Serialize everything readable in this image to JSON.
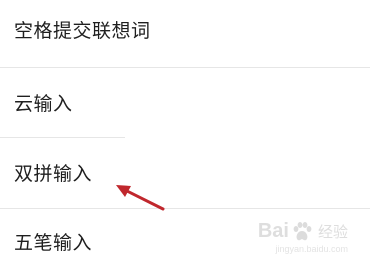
{
  "settings_list": {
    "items": [
      {
        "label": "空格提交联想词"
      },
      {
        "label": "云输入"
      },
      {
        "label": "双拼输入"
      },
      {
        "label": "五笔输入"
      }
    ]
  },
  "annotation": {
    "arrow_color": "#c0272d",
    "points_to": "双拼输入"
  },
  "watermark": {
    "brand_left": "Bai",
    "brand_right": "经验",
    "url": "jingyan.baidu.com"
  }
}
